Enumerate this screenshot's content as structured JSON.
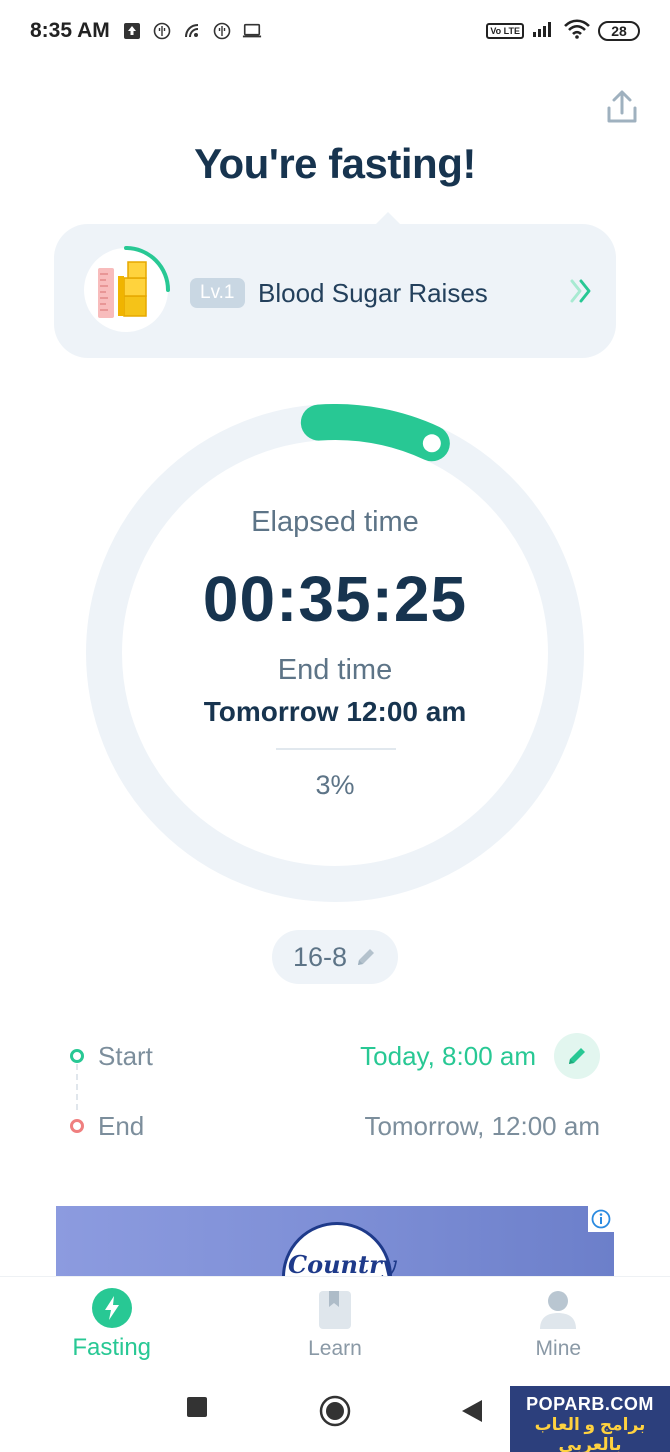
{
  "status_bar": {
    "time": "8:35 AM",
    "battery": "28",
    "network_badge": "Vo LTE",
    "icons": [
      "upload-icon",
      "tinder-icon",
      "signal-icon",
      "tinder-icon",
      "laptop-icon",
      "cellular-signal-icon",
      "wifi-icon",
      "battery-icon"
    ]
  },
  "header": {
    "title": "You're fasting!",
    "share_icon": "share-icon"
  },
  "stage": {
    "level": "Lv.1",
    "name": "Blood Sugar Raises",
    "progress": 0.25,
    "accent": "#28c894"
  },
  "timer": {
    "elapsed_label": "Elapsed time",
    "elapsed_value": "00:35:25",
    "end_label": "End time",
    "end_value": "Tomorrow 12:00 am",
    "percent": "3%",
    "progress": 0.03
  },
  "plan": {
    "label": "16-8"
  },
  "schedule": {
    "start_label": "Start",
    "start_value": "Today, 8:00 am",
    "end_label": "End",
    "end_value": "Tomorrow, 12:00 am"
  },
  "ad": {
    "text": "Country"
  },
  "bottom_nav": {
    "items": [
      {
        "label": "Fasting",
        "icon": "lightning-icon",
        "active": true
      },
      {
        "label": "Learn",
        "icon": "book-icon",
        "active": false
      },
      {
        "label": "Mine",
        "icon": "person-icon",
        "active": false
      }
    ]
  },
  "watermark": {
    "top": "POPARB.COM",
    "bottom": "برامج و العاب بالعربي"
  },
  "colors": {
    "accent": "#28c894",
    "title": "#17344f",
    "card_bg": "#eef3f8",
    "end_dot": "#ef7f7f"
  }
}
